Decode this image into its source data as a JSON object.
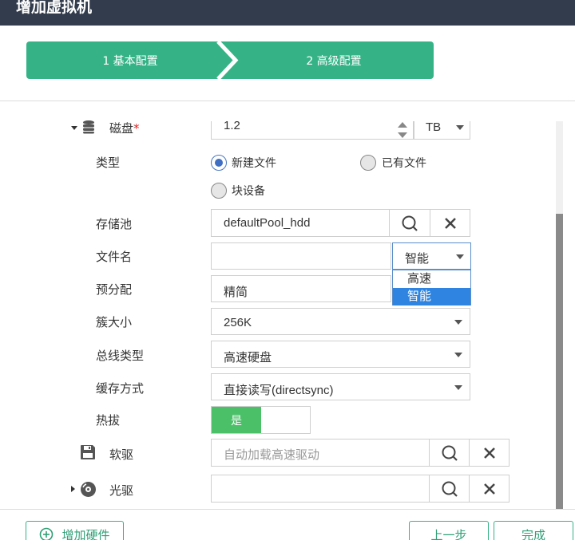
{
  "window": {
    "title": "增加虚拟机"
  },
  "steps": [
    {
      "label": "1 基本配置"
    },
    {
      "label": "2 高级配置"
    }
  ],
  "disk": {
    "label": "磁盘",
    "required_mark": "*",
    "size_value": "1.2",
    "unit": "TB",
    "type_label": "类型",
    "type_options": [
      {
        "label": "新建文件",
        "selected": true
      },
      {
        "label": "已有文件",
        "selected": false
      },
      {
        "label": "块设备",
        "selected": false
      }
    ],
    "pool_label": "存储池",
    "pool_value": "defaultPool_hdd",
    "filename_label": "文件名",
    "filename_value": "",
    "filename_mode": "智能",
    "filename_mode_options": [
      "高速",
      "智能"
    ],
    "prealloc_label": "预分配",
    "prealloc_value": "精简",
    "cluster_label": "簇大小",
    "cluster_value": "256K",
    "bus_label": "总线类型",
    "bus_value": "高速硬盘",
    "cache_label": "缓存方式",
    "cache_value": "直接读写(directsync)",
    "hotplug_label": "热拔",
    "hotplug_on_label": "是"
  },
  "floppy": {
    "label": "软驱",
    "placeholder": "自动加载高速驱动"
  },
  "cdrom": {
    "label": "光驱",
    "value": ""
  },
  "footer": {
    "add_hardware": "增加硬件",
    "prev": "上一步",
    "finish": "完成"
  },
  "colors": {
    "accent": "#35b387",
    "titlebar": "#323c4c",
    "toggle_on": "#4cc068",
    "dropdown_selected": "#2e84e0"
  }
}
